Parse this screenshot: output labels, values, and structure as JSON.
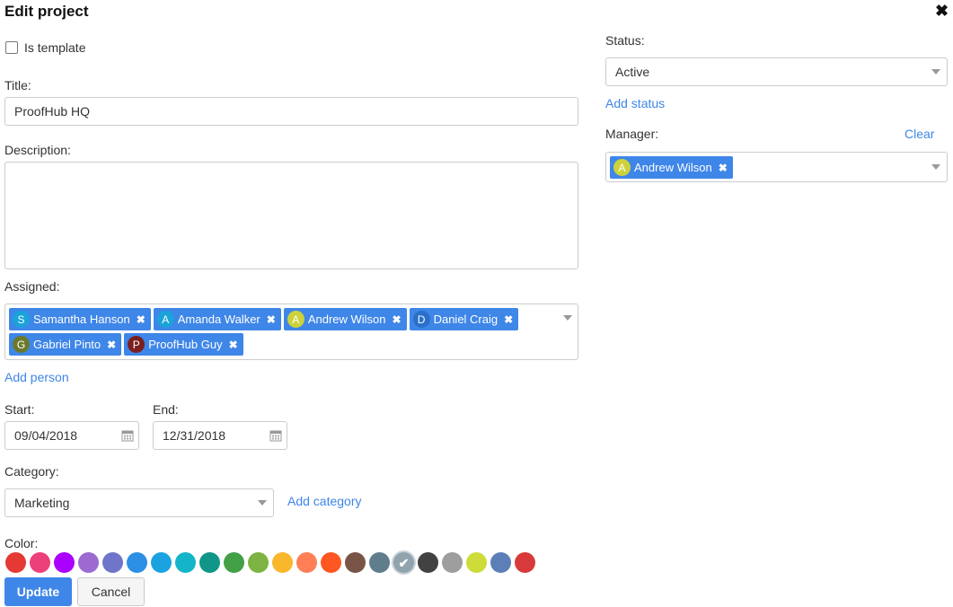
{
  "header": {
    "title": "Edit project",
    "close_glyph": "✖"
  },
  "template": {
    "label": "Is template",
    "checked": false
  },
  "title_field": {
    "label": "Title:",
    "value": "ProofHub HQ"
  },
  "description_field": {
    "label": "Description:",
    "value": ""
  },
  "assigned": {
    "label": "Assigned:",
    "people": [
      {
        "initial": "S",
        "name": "Samantha Hanson",
        "color": "#1aa3d9"
      },
      {
        "initial": "A",
        "name": "Amanda Walker",
        "color": "#1aa3d9"
      },
      {
        "initial": "A",
        "name": "Andrew Wilson",
        "color": "#cdd23a"
      },
      {
        "initial": "D",
        "name": "Daniel Craig",
        "color": "#2a6fc9"
      },
      {
        "initial": "G",
        "name": "Gabriel Pinto",
        "color": "#6b7a2a"
      },
      {
        "initial": "P",
        "name": "ProofHub Guy",
        "color": "#7a1f1f"
      }
    ],
    "add_link": "Add person"
  },
  "start": {
    "label": "Start:",
    "value": "09/04/2018"
  },
  "end": {
    "label": "End:",
    "value": "12/31/2018"
  },
  "category": {
    "label": "Category:",
    "value": "Marketing",
    "add_link": "Add category"
  },
  "color": {
    "label": "Color:",
    "swatches": [
      "#e53935",
      "#ec407a",
      "#aa00ff",
      "#9c6ad0",
      "#6f76c9",
      "#2a8fe5",
      "#1aa3e0",
      "#13b5c9",
      "#0f9688",
      "#43a047",
      "#7cb342",
      "#f9b72b",
      "#ff7f57",
      "#ff5722",
      "#795548",
      "#607d8b",
      "#90a4ae",
      "#424242",
      "#9e9e9e",
      "#cddc39",
      "#5c7fb8",
      "#d83a3a"
    ],
    "selected_index": 16
  },
  "status": {
    "label": "Status:",
    "value": "Active",
    "add_link": "Add status"
  },
  "manager": {
    "label": "Manager:",
    "clear_link": "Clear",
    "person": {
      "initial": "A",
      "name": "Andrew Wilson",
      "color": "#cdd23a"
    }
  },
  "buttons": {
    "update": "Update",
    "cancel": "Cancel"
  },
  "icons": {
    "chip_remove": "✖",
    "check": "✔"
  }
}
